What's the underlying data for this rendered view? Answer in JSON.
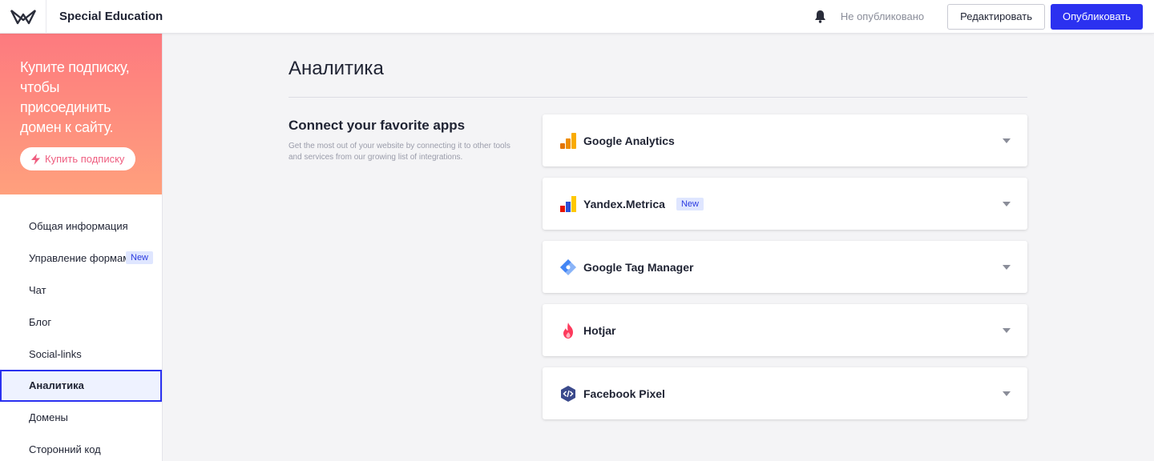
{
  "header": {
    "site_name": "Special Education",
    "status": "Не опубликовано",
    "edit_label": "Редактировать",
    "publish_label": "Опубликовать",
    "icons": {
      "logo": "wix-w-logo-icon",
      "bell": "bell-icon"
    }
  },
  "promo": {
    "text": "Купите подписку, чтобы присоединить домен к сайту.",
    "button_label": "Купить подписку",
    "button_icon": "lightning-icon"
  },
  "sidebar": {
    "items": [
      {
        "label": "Общая информация"
      },
      {
        "label": "Управление формами",
        "badge": "New"
      },
      {
        "label": "Чат"
      },
      {
        "label": "Блог"
      },
      {
        "label": "Social-links"
      },
      {
        "label": "Аналитика",
        "active": true
      },
      {
        "label": "Домены"
      },
      {
        "label": "Сторонний код"
      }
    ]
  },
  "main": {
    "title": "Аналитика",
    "intro_title": "Connect your favorite apps",
    "intro_text": "Get the most out of your website by connecting it to other tools and services from our growing list of integrations.",
    "integrations": [
      {
        "name": "Google Analytics",
        "icon": "google-analytics-icon"
      },
      {
        "name": "Yandex.Metrica",
        "icon": "yandex-metrica-icon",
        "badge": "New"
      },
      {
        "name": "Google Tag Manager",
        "icon": "google-tag-manager-icon"
      },
      {
        "name": "Hotjar",
        "icon": "hotjar-icon"
      },
      {
        "name": "Facebook Pixel",
        "icon": "facebook-pixel-icon"
      }
    ]
  },
  "colors": {
    "accent": "#2b31f0",
    "promo_gradient_start": "#fd7a7f",
    "promo_gradient_end": "#ffa07d",
    "badge_bg": "#dfe6ff",
    "badge_text": "#2b3be0"
  }
}
